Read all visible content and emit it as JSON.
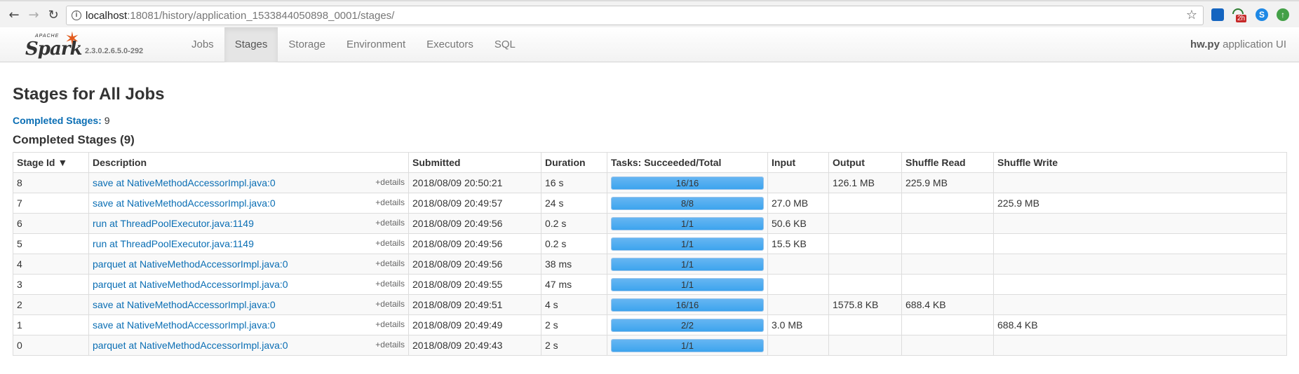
{
  "browser": {
    "url_host": "localhost",
    "url_rest": ":18081/history/application_1533844050898_0001/stages/",
    "ext_badge": "2h",
    "ext_skype": "S"
  },
  "spark": {
    "logo_apache": "APACHE",
    "logo_word": "Spark",
    "version": "2.3.0.2.6.5.0-292",
    "tabs": [
      "Jobs",
      "Stages",
      "Storage",
      "Environment",
      "Executors",
      "SQL"
    ],
    "active_tab": "Stages",
    "app_name": "hw.py",
    "app_suffix": "application UI"
  },
  "page": {
    "title": "Stages for All Jobs",
    "summary_label": "Completed Stages:",
    "summary_value": "9",
    "section_title": "Completed Stages (9)"
  },
  "table": {
    "headers": [
      "Stage Id ▼",
      "Description",
      "Submitted",
      "Duration",
      "Tasks: Succeeded/Total",
      "Input",
      "Output",
      "Shuffle Read",
      "Shuffle Write"
    ],
    "details_label": "+details",
    "rows": [
      {
        "id": "8",
        "desc": "save at NativeMethodAccessorImpl.java:0",
        "submitted": "2018/08/09 20:50:21",
        "duration": "16 s",
        "tasks": "16/16",
        "progress": 1.0,
        "input": "",
        "output": "126.1 MB",
        "shuffle_read": "225.9 MB",
        "shuffle_write": ""
      },
      {
        "id": "7",
        "desc": "save at NativeMethodAccessorImpl.java:0",
        "submitted": "2018/08/09 20:49:57",
        "duration": "24 s",
        "tasks": "8/8",
        "progress": 1.0,
        "input": "27.0 MB",
        "output": "",
        "shuffle_read": "",
        "shuffle_write": "225.9 MB"
      },
      {
        "id": "6",
        "desc": "run at ThreadPoolExecutor.java:1149",
        "submitted": "2018/08/09 20:49:56",
        "duration": "0.2 s",
        "tasks": "1/1",
        "progress": 1.0,
        "input": "50.6 KB",
        "output": "",
        "shuffle_read": "",
        "shuffle_write": ""
      },
      {
        "id": "5",
        "desc": "run at ThreadPoolExecutor.java:1149",
        "submitted": "2018/08/09 20:49:56",
        "duration": "0.2 s",
        "tasks": "1/1",
        "progress": 1.0,
        "input": "15.5 KB",
        "output": "",
        "shuffle_read": "",
        "shuffle_write": ""
      },
      {
        "id": "4",
        "desc": "parquet at NativeMethodAccessorImpl.java:0",
        "submitted": "2018/08/09 20:49:56",
        "duration": "38 ms",
        "tasks": "1/1",
        "progress": 1.0,
        "input": "",
        "output": "",
        "shuffle_read": "",
        "shuffle_write": ""
      },
      {
        "id": "3",
        "desc": "parquet at NativeMethodAccessorImpl.java:0",
        "submitted": "2018/08/09 20:49:55",
        "duration": "47 ms",
        "tasks": "1/1",
        "progress": 1.0,
        "input": "",
        "output": "",
        "shuffle_read": "",
        "shuffle_write": ""
      },
      {
        "id": "2",
        "desc": "save at NativeMethodAccessorImpl.java:0",
        "submitted": "2018/08/09 20:49:51",
        "duration": "4 s",
        "tasks": "16/16",
        "progress": 1.0,
        "input": "",
        "output": "1575.8 KB",
        "shuffle_read": "688.4 KB",
        "shuffle_write": ""
      },
      {
        "id": "1",
        "desc": "save at NativeMethodAccessorImpl.java:0",
        "submitted": "2018/08/09 20:49:49",
        "duration": "2 s",
        "tasks": "2/2",
        "progress": 1.0,
        "input": "3.0 MB",
        "output": "",
        "shuffle_read": "",
        "shuffle_write": "688.4 KB"
      },
      {
        "id": "0",
        "desc": "parquet at NativeMethodAccessorImpl.java:0",
        "submitted": "2018/08/09 20:49:43",
        "duration": "2 s",
        "tasks": "1/1",
        "progress": 1.0,
        "input": "",
        "output": "",
        "shuffle_read": "",
        "shuffle_write": ""
      }
    ]
  },
  "colors": {
    "link": "#0a6eb4",
    "progress_fill": "#3da4ee",
    "spark_orange": "#e25a1c"
  }
}
